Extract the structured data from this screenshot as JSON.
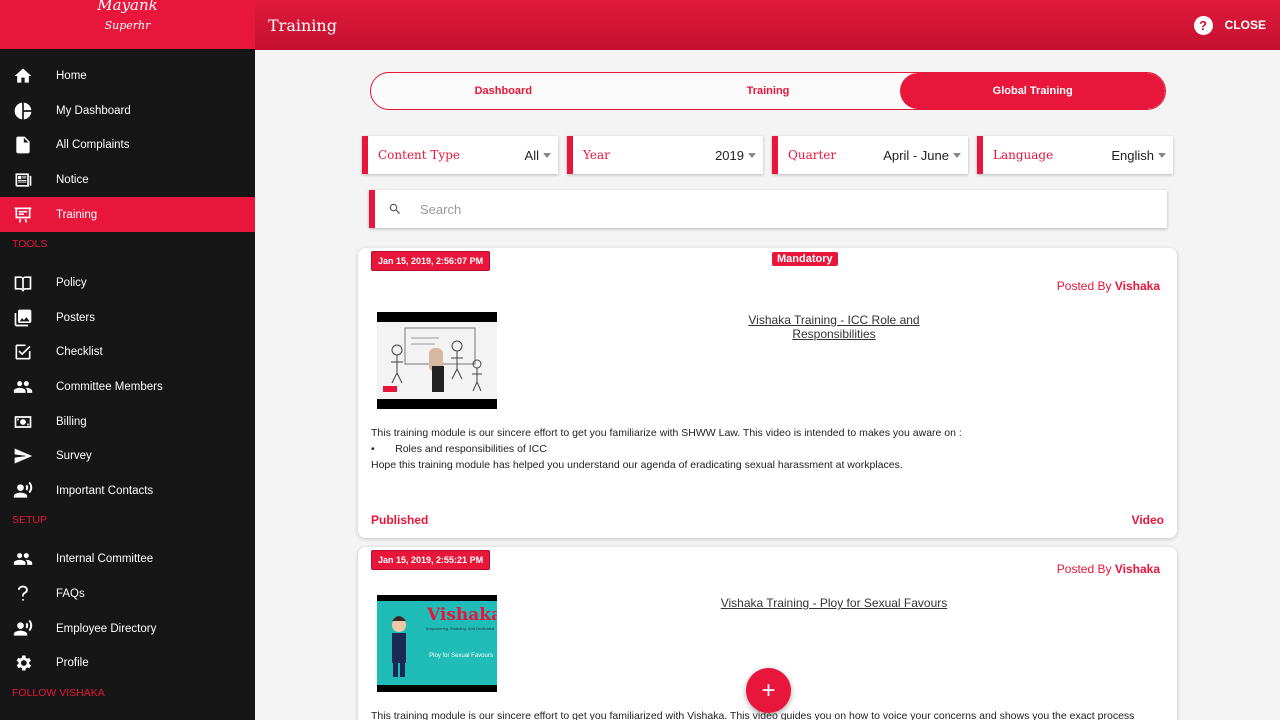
{
  "brand": {
    "name": "Mayank",
    "subtitle": "Superhr"
  },
  "sidebar": {
    "main": [
      {
        "label": "Home",
        "icon": "home-icon"
      },
      {
        "label": "My Dashboard",
        "icon": "pie-chart-icon"
      },
      {
        "label": "All Complaints",
        "icon": "document-icon"
      },
      {
        "label": "Notice",
        "icon": "newspaper-icon"
      },
      {
        "label": "Training",
        "icon": "presentation-icon",
        "active": true
      }
    ],
    "tools_title": "TOOLS",
    "tools": [
      {
        "label": "Policy",
        "icon": "book-icon"
      },
      {
        "label": "Posters",
        "icon": "images-icon"
      },
      {
        "label": "Checklist",
        "icon": "checkbox-icon"
      },
      {
        "label": "Committee Members",
        "icon": "people-icon"
      },
      {
        "label": "Billing",
        "icon": "money-icon"
      },
      {
        "label": "Survey",
        "icon": "send-icon"
      },
      {
        "label": "Important Contacts",
        "icon": "contacts-icon"
      }
    ],
    "setup_title": "SETUP",
    "setup": [
      {
        "label": "Internal Committee",
        "icon": "people-icon"
      },
      {
        "label": "FAQs",
        "icon": "question-icon"
      },
      {
        "label": "Employee Directory",
        "icon": "contacts-icon"
      },
      {
        "label": "Profile",
        "icon": "gear-icon"
      }
    ],
    "follow_title": "FOLLOW VISHAKA"
  },
  "header": {
    "title": "Training",
    "close_label": "CLOSE",
    "help_glyph": "?"
  },
  "tabs": [
    {
      "label": "Dashboard",
      "active": false
    },
    {
      "label": "Training",
      "active": false
    },
    {
      "label": "Global Training",
      "active": true
    }
  ],
  "filters": {
    "content_type": {
      "label": "Content Type",
      "value": "All"
    },
    "year": {
      "label": "Year",
      "value": "2019"
    },
    "quarter": {
      "label": "Quarter",
      "value": "April - June"
    },
    "language": {
      "label": "Language",
      "value": "English"
    }
  },
  "search": {
    "placeholder": "Search"
  },
  "cards": [
    {
      "date": "Jan 15, 2019, 2:56:07 PM",
      "badge": "Mandatory",
      "posted_prefix": "Posted By",
      "posted_by": "Vishaka",
      "title": "Vishaka Training - ICC Role and Responsibilities",
      "desc_line1": "This training module is our sincere effort to get you familiarize with SHWW Law. This video is intended to makes you aware on :",
      "desc_bullet": "Roles and  responsibilities of ICC",
      "desc_line3": "Hope this training module has helped you understand our agenda of eradicating sexual harassment at workplaces.",
      "status": "Published",
      "type": "Video"
    },
    {
      "date": "Jan 15, 2019, 2:55:21 PM",
      "posted_prefix": "Posted By",
      "posted_by": "Vishaka",
      "title": "Vishaka Training - Ploy for Sexual Favours",
      "thumb_brand": "Vishaka",
      "thumb_tagline": "Empowering. Enabling. And Dedicated",
      "thumb_caption": "Ploy for Sexual Favours",
      "desc_line1": "This training module is our sincere effort to get you familiarized with Vishaka. This video guides you on how to voice your concerns and shows you the exact process"
    }
  ],
  "fab": {
    "label": "+"
  },
  "colors": {
    "accent": "#e8163a",
    "sidebar_bg": "#161616",
    "page_bg": "#f4f4f4"
  }
}
